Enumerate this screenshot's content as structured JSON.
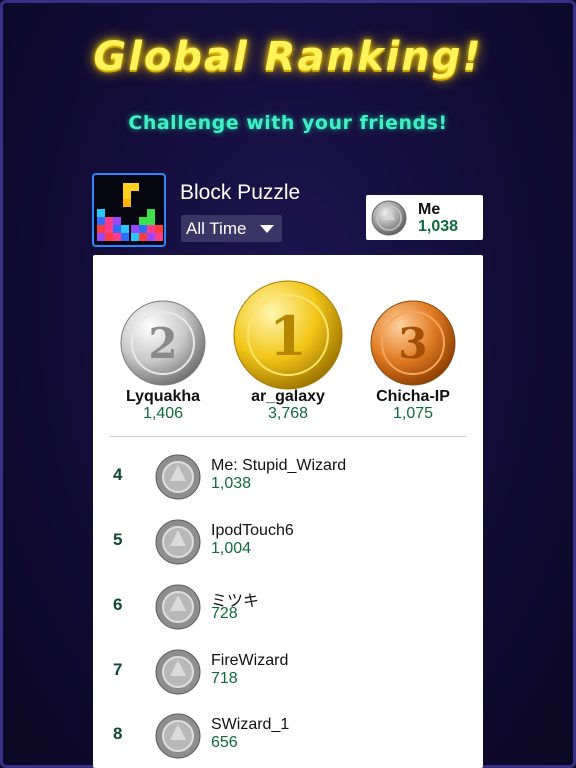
{
  "header": {
    "title": "Global Ranking!",
    "subtitle": "Challenge with your friends!"
  },
  "game": {
    "icon": "block-puzzle-icon",
    "title": "Block Puzzle",
    "period": "All Time"
  },
  "me_card": {
    "label": "Me",
    "score": "1,038"
  },
  "podium": [
    {
      "place": "2",
      "name": "Lyquakha",
      "score": "1,406",
      "medal": "silver"
    },
    {
      "place": "1",
      "name": "ar_galaxy",
      "score": "3,768",
      "medal": "gold"
    },
    {
      "place": "3",
      "name": "Chicha-IP",
      "score": "1,075",
      "medal": "bronze"
    }
  ],
  "rows": [
    {
      "rank": "4",
      "name": "Me: Stupid_Wizard",
      "score": "1,038"
    },
    {
      "rank": "5",
      "name": "IpodTouch6",
      "score": "1,004"
    },
    {
      "rank": "6",
      "name": "ミツキ",
      "score": "728"
    },
    {
      "rank": "7",
      "name": "FireWizard",
      "score": "718"
    },
    {
      "rank": "8",
      "name": "SWizard_1",
      "score": "656"
    }
  ],
  "colors": {
    "background": "#120c36",
    "title": "#fff35a",
    "subtitle": "#3ff0c4",
    "score": "#0f6b3c",
    "gold": "#f2c618",
    "silver": "#c9c9c9",
    "bronze": "#e07a22"
  }
}
